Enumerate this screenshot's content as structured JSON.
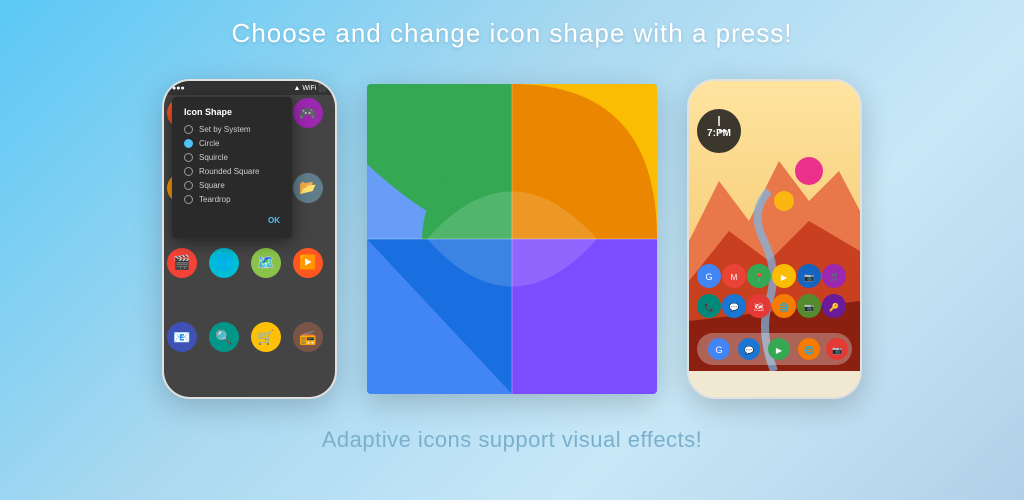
{
  "header": {
    "title": "Choose and change icon shape with a press!"
  },
  "footer": {
    "text": "Adaptive icons support visual effects!"
  },
  "dialog": {
    "title": "Icon Shape",
    "options": [
      {
        "label": "Set by System",
        "selected": false
      },
      {
        "label": "Circle",
        "selected": true
      },
      {
        "label": "Squircle",
        "selected": false
      },
      {
        "label": "Rounded Square",
        "selected": false
      },
      {
        "label": "Square",
        "selected": false
      },
      {
        "label": "Teardrop",
        "selected": false
      }
    ],
    "ok_button": "OK"
  },
  "colors": {
    "background_start": "#5bc8f5",
    "background_end": "#a8d8f0",
    "dialog_bg": "#2a2a2a",
    "accent": "#4fc3f7"
  },
  "center_image": {
    "alt": "Adaptive icon shapes preview"
  },
  "right_phone": {
    "alt": "Phone with adaptive icon visual effects"
  }
}
